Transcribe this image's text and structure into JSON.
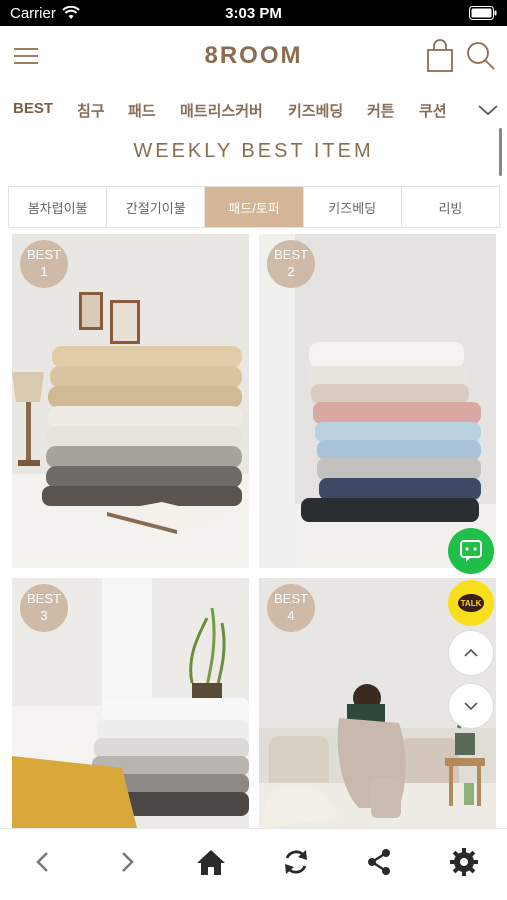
{
  "status_bar": {
    "carrier": "Carrier",
    "time": "3:03 PM"
  },
  "header": {
    "logo": "8ROOM"
  },
  "categories": [
    "BEST",
    "침구",
    "패드",
    "매트리스커버",
    "키즈베딩",
    "커튼",
    "쿠션"
  ],
  "section_title": "WEEKLY BEST ITEM",
  "tabs": [
    "봄차렵이불",
    "간절기이불",
    "패드/토퍼",
    "키즈베딩",
    "리빙"
  ],
  "active_tab": "패드/토퍼",
  "products": [
    {
      "badge_label": "BEST",
      "rank": "1"
    },
    {
      "badge_label": "BEST",
      "rank": "2"
    },
    {
      "badge_label": "BEST",
      "rank": "3"
    },
    {
      "badge_label": "BEST",
      "rank": "4"
    }
  ],
  "floating": {
    "talk_label": "TALK"
  },
  "colors": {
    "brand": "#8c6d4f",
    "tab_active": "#d4b596",
    "chat_green": "#1fbf4a",
    "kakao_yellow": "#f7df1e"
  },
  "icons": [
    "wifi-icon",
    "battery-icon",
    "menu-icon",
    "bag-icon",
    "search-icon",
    "chevron-down-icon",
    "chat-icon",
    "kakaotalk-icon",
    "arrow-up-icon",
    "arrow-down-icon",
    "back-icon",
    "forward-icon",
    "home-icon",
    "refresh-icon",
    "share-icon",
    "settings-icon"
  ]
}
